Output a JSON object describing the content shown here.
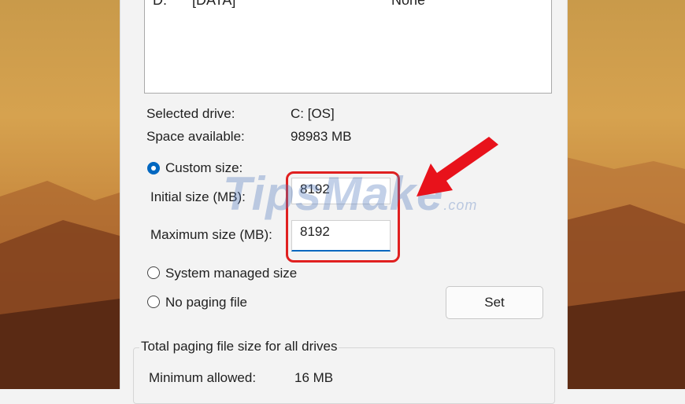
{
  "drive_list": {
    "rows": [
      {
        "letter": "D:",
        "label": "[DATA]",
        "paging": "None"
      }
    ]
  },
  "selected_drive": {
    "label": "Selected drive:",
    "value": "C:  [OS]"
  },
  "space_available": {
    "label": "Space available:",
    "value": "98983 MB"
  },
  "options": {
    "custom_size": "Custom size:",
    "system_managed": "System managed size",
    "no_paging": "No paging file",
    "selected": "custom_size"
  },
  "initial_size": {
    "label": "Initial size (MB):",
    "value": "8192"
  },
  "maximum_size": {
    "label": "Maximum size (MB):",
    "value": "8192"
  },
  "set_button": "Set",
  "total_group": {
    "title": "Total paging file size for all drives",
    "minimum_label": "Minimum allowed:",
    "minimum_value": "16 MB"
  },
  "watermark": {
    "brand": "TipsMake",
    "suffix": ".com"
  },
  "colors": {
    "accent": "#0067c0",
    "highlight": "#e02020"
  }
}
